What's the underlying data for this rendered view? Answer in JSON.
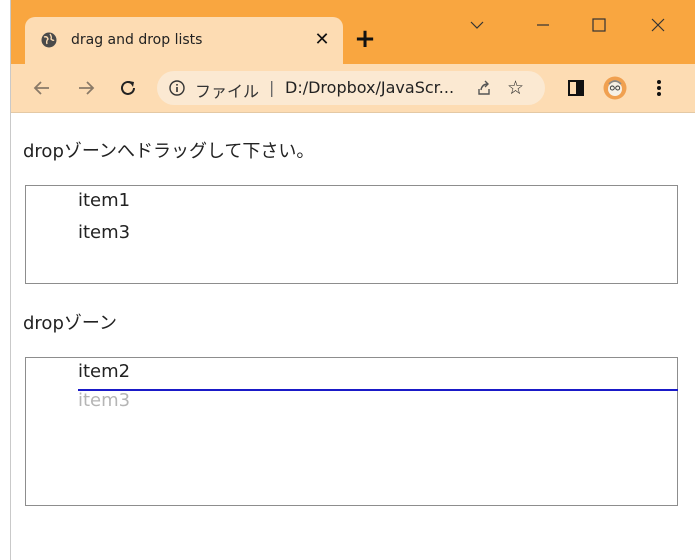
{
  "browser": {
    "tab": {
      "title": "drag and drop lists",
      "close_label": "✕"
    },
    "new_tab_label": "+",
    "address": {
      "scheme_label": "ファイル",
      "separator": "|",
      "url": "D:/Dropbox/JavaScr..."
    },
    "colors": {
      "frame": "#f9a640",
      "tab": "#fddcb3",
      "omnibox": "#fbe9d2"
    },
    "icons": [
      "globe-icon",
      "close-icon",
      "plus-icon",
      "chevron-down-icon",
      "minimize-icon",
      "maximize-icon",
      "window-close-icon",
      "back-arrow-icon",
      "forward-arrow-icon",
      "reload-icon",
      "info-icon",
      "share-icon",
      "star-icon",
      "side-panel-icon",
      "profile-avatar-icon",
      "kebab-menu-icon"
    ]
  },
  "page": {
    "source": {
      "heading": "dropゾーンへドラッグして下さい。",
      "items": [
        "item1",
        "item3"
      ]
    },
    "target": {
      "heading": "dropゾーン",
      "items": [
        "item2"
      ],
      "ghost_item": "item3",
      "drop_indicator_color": "#1a1ac8"
    }
  }
}
